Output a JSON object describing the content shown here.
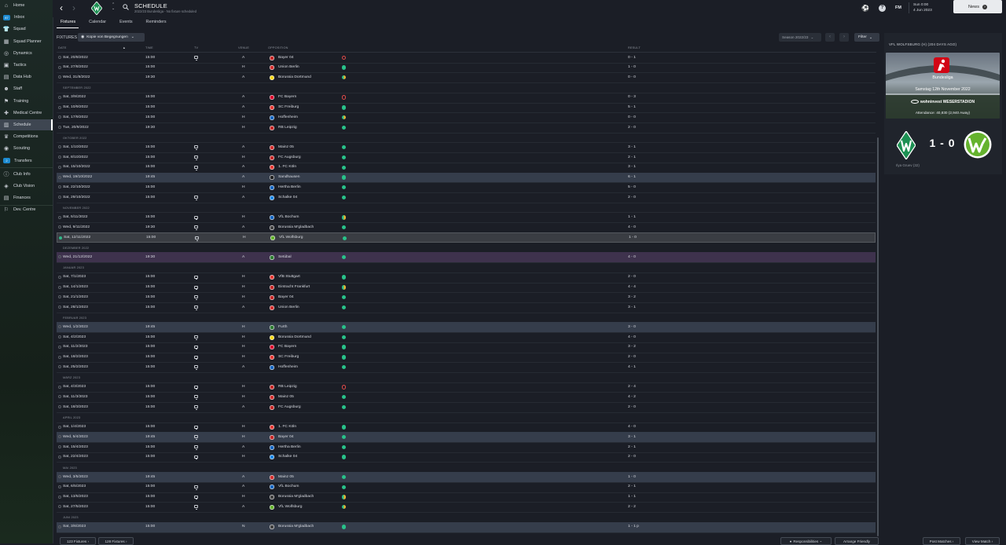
{
  "sidebar": {
    "items": [
      {
        "label": "Home",
        "icon": "home-icon"
      },
      {
        "label": "Inbox",
        "icon": "inbox-icon",
        "badge": "87"
      },
      {
        "label": "Squad",
        "icon": "shirt-icon"
      },
      {
        "label": "Squad Planner",
        "icon": "planner-icon"
      },
      {
        "label": "Dynamics",
        "icon": "dynamics-icon"
      },
      {
        "label": "Tactics",
        "icon": "tactics-icon"
      },
      {
        "label": "Data Hub",
        "icon": "data-hub-icon"
      },
      {
        "label": "Staff",
        "icon": "staff-icon"
      },
      {
        "label": "Training",
        "icon": "training-icon"
      },
      {
        "label": "Medical Centre",
        "icon": "medical-icon"
      },
      {
        "label": "Schedule",
        "icon": "schedule-icon",
        "active": true
      },
      {
        "label": "Competitions",
        "icon": "trophy-icon"
      },
      {
        "label": "Scouting",
        "icon": "scouting-icon"
      },
      {
        "label": "Transfers",
        "icon": "transfers-icon",
        "badge": "2"
      },
      {
        "label": "Club Info",
        "icon": "club-info-icon"
      },
      {
        "label": "Club Vision",
        "icon": "club-vision-icon"
      },
      {
        "label": "Finances",
        "icon": "finances-icon"
      },
      {
        "label": "Dev. Centre",
        "icon": "dev-centre-icon"
      }
    ]
  },
  "header": {
    "title": "SCHEDULE",
    "subtitle": "2022/23 Bundesliga - No fixture scheduled",
    "fm_label": "FM",
    "date_line1": "Sun 0:00",
    "date_line2": "4 Jun 2023",
    "news_label": "News"
  },
  "tabs": [
    "Fixtures",
    "Calendar",
    "Events",
    "Reminders"
  ],
  "fixtures": {
    "label": "FIXTURES",
    "view_option": "Kopie von Begegnungen",
    "season": "Season 2022/23",
    "filter_label": "Filter",
    "columns": {
      "date": "Date",
      "time": "Time",
      "tv": "TV",
      "venue": "Venue",
      "opposition": "Opposition",
      "result": "Result"
    },
    "rows": [
      {
        "date": "Sat, 20/8/2022",
        "time": "15:00",
        "tv": true,
        "venue": "A",
        "opp": "Bayer 04",
        "outcome": "l",
        "result": "0 - 1",
        "badge": "#c62828"
      },
      {
        "date": "Sat, 27/8/2022",
        "time": "15:00",
        "tv": false,
        "venue": "H",
        "opp": "Union Berlin",
        "outcome": "w",
        "result": "1 - 0",
        "badge": "#d32f2f"
      },
      {
        "date": "Wed, 31/8/2022",
        "time": "19:30",
        "tv": false,
        "venue": "A",
        "opp": "Borussia Dortmund",
        "outcome": "d",
        "result": "0 - 0",
        "badge": "#f9d71c"
      },
      {
        "month": "September 2022"
      },
      {
        "date": "Sat, 3/9/2022",
        "time": "15:00",
        "tv": false,
        "venue": "A",
        "opp": "FC Bayern",
        "outcome": "l",
        "result": "0 - 3",
        "badge": "#dc052d"
      },
      {
        "date": "Sat, 10/9/2022",
        "time": "15:00",
        "tv": false,
        "venue": "A",
        "opp": "SC Freiburg",
        "outcome": "w",
        "result": "5 - 1",
        "badge": "#e53935"
      },
      {
        "date": "Sat, 17/9/2022",
        "time": "15:00",
        "tv": false,
        "venue": "H",
        "opp": "Hoffenheim",
        "outcome": "d",
        "result": "0 - 0",
        "badge": "#1565c0"
      },
      {
        "date": "Tue, 20/9/2022",
        "time": "19:30",
        "tv": false,
        "venue": "H",
        "opp": "RB Leipzig",
        "outcome": "w",
        "result": "2 - 0",
        "badge": "#c62828"
      },
      {
        "month": "Oktober 2022"
      },
      {
        "date": "Sat, 1/10/2022",
        "time": "15:00",
        "tv": true,
        "venue": "A",
        "opp": "Mainz 05",
        "outcome": "w",
        "result": "3 - 1",
        "badge": "#d32f2f"
      },
      {
        "date": "Sat, 8/10/2022",
        "time": "15:00",
        "tv": true,
        "venue": "H",
        "opp": "FC Augsburg",
        "outcome": "w",
        "result": "2 - 1",
        "badge": "#c62828"
      },
      {
        "date": "Sat, 15/10/2022",
        "time": "15:00",
        "tv": true,
        "venue": "A",
        "opp": "1. FC Köln",
        "outcome": "w",
        "result": "3 - 1",
        "badge": "#e53935"
      },
      {
        "date": "Wed, 19/10/2022",
        "time": "19:45",
        "tv": false,
        "venue": "A",
        "opp": "Sandhausen",
        "outcome": "w",
        "result": "6 - 1",
        "badge": "#212121",
        "hl": "blue"
      },
      {
        "date": "Sat, 22/10/2022",
        "time": "15:00",
        "tv": false,
        "venue": "H",
        "opp": "Hertha Berlin",
        "outcome": "w",
        "result": "5 - 0",
        "badge": "#1565c0"
      },
      {
        "date": "Sat, 29/10/2022",
        "time": "15:00",
        "tv": true,
        "venue": "A",
        "opp": "Schalke 04",
        "outcome": "w",
        "result": "2 - 0",
        "badge": "#1e88e5"
      },
      {
        "month": "November 2022"
      },
      {
        "date": "Sat, 5/11/2022",
        "time": "15:00",
        "tv": true,
        "venue": "H",
        "opp": "VfL Bochum",
        "outcome": "d",
        "result": "1 - 1",
        "badge": "#1565c0"
      },
      {
        "date": "Wed, 9/11/2022",
        "time": "19:30",
        "tv": true,
        "venue": "A",
        "opp": "Borussia M'gladbach",
        "outcome": "w",
        "result": "4 - 0",
        "badge": "#424242"
      },
      {
        "date": "Sat, 12/11/2022",
        "time": "15:00",
        "tv": true,
        "venue": "H",
        "opp": "VfL Wolfsburg",
        "outcome": "w",
        "result": "1 - 0",
        "badge": "#65b32e",
        "hl": "gray",
        "selected": true
      },
      {
        "month": "Dezember 2022"
      },
      {
        "date": "Wed, 21/12/2022",
        "time": "19:30",
        "tv": false,
        "venue": "A",
        "opp": "Setúbal",
        "outcome": "w",
        "result": "4 - 0",
        "badge": "#2e7d32",
        "hl": "purple"
      },
      {
        "month": "Januar 2023"
      },
      {
        "date": "Sat, 7/1/2023",
        "time": "15:00",
        "tv": true,
        "venue": "H",
        "opp": "VfB Stuttgart",
        "outcome": "w",
        "result": "2 - 0",
        "badge": "#e53935"
      },
      {
        "date": "Sat, 14/1/2023",
        "time": "15:00",
        "tv": true,
        "venue": "H",
        "opp": "Eintracht Frankfurt",
        "outcome": "d",
        "result": "4 - 4",
        "badge": "#c62828"
      },
      {
        "date": "Sat, 21/1/2023",
        "time": "15:00",
        "tv": true,
        "venue": "H",
        "opp": "Bayer 04",
        "outcome": "w",
        "result": "3 - 2",
        "badge": "#c62828"
      },
      {
        "date": "Sat, 28/1/2023",
        "time": "15:00",
        "tv": true,
        "venue": "A",
        "opp": "Union Berlin",
        "outcome": "w",
        "result": "3 - 1",
        "badge": "#d32f2f"
      },
      {
        "month": "Februar 2023"
      },
      {
        "date": "Wed, 1/2/2023",
        "time": "19:45",
        "tv": false,
        "venue": "H",
        "opp": "Furth",
        "outcome": "w",
        "result": "3 - 0",
        "badge": "#2e7d32",
        "hl": "blue"
      },
      {
        "date": "Sat, 4/2/2023",
        "time": "15:00",
        "tv": true,
        "venue": "H",
        "opp": "Borussia Dortmund",
        "outcome": "w",
        "result": "4 - 0",
        "badge": "#f9d71c"
      },
      {
        "date": "Sat, 11/2/2023",
        "time": "15:00",
        "tv": true,
        "venue": "H",
        "opp": "FC Bayern",
        "outcome": "w",
        "result": "3 - 2",
        "badge": "#dc052d"
      },
      {
        "date": "Sat, 18/2/2023",
        "time": "15:00",
        "tv": true,
        "venue": "H",
        "opp": "SC Freiburg",
        "outcome": "w",
        "result": "2 - 0",
        "badge": "#e53935"
      },
      {
        "date": "Sat, 25/2/2023",
        "time": "15:00",
        "tv": true,
        "venue": "A",
        "opp": "Hoffenheim",
        "outcome": "w",
        "result": "4 - 1",
        "badge": "#1565c0"
      },
      {
        "month": "März 2023"
      },
      {
        "date": "Sat, 4/3/2023",
        "time": "15:00",
        "tv": true,
        "venue": "H",
        "opp": "RB Leipzig",
        "outcome": "l",
        "result": "2 - 4",
        "badge": "#c62828"
      },
      {
        "date": "Sat, 11/3/2023",
        "time": "15:00",
        "tv": true,
        "venue": "H",
        "opp": "Mainz 05",
        "outcome": "w",
        "result": "4 - 2",
        "badge": "#d32f2f"
      },
      {
        "date": "Sat, 18/3/2023",
        "time": "15:00",
        "tv": true,
        "venue": "A",
        "opp": "FC Augsburg",
        "outcome": "w",
        "result": "2 - 0",
        "badge": "#c62828"
      },
      {
        "month": "April 2023"
      },
      {
        "date": "Sat, 1/4/2023",
        "time": "15:00",
        "tv": true,
        "venue": "H",
        "opp": "1. FC Köln",
        "outcome": "w",
        "result": "4 - 0",
        "badge": "#e53935"
      },
      {
        "date": "Wed, 5/4/2023",
        "time": "19:45",
        "tv": true,
        "venue": "H",
        "opp": "Bayer 04",
        "outcome": "w",
        "result": "3 - 1",
        "badge": "#c62828",
        "hl": "blue"
      },
      {
        "date": "Sat, 15/4/2023",
        "time": "15:00",
        "tv": true,
        "venue": "A",
        "opp": "Hertha Berlin",
        "outcome": "w",
        "result": "2 - 1",
        "badge": "#1565c0"
      },
      {
        "date": "Sat, 22/4/2023",
        "time": "15:00",
        "tv": true,
        "venue": "H",
        "opp": "Schalke 04",
        "outcome": "w",
        "result": "2 - 0",
        "badge": "#1e88e5"
      },
      {
        "month": "Mai 2023"
      },
      {
        "date": "Wed, 3/5/2023",
        "time": "19:45",
        "tv": false,
        "venue": "A",
        "opp": "Mainz 05",
        "outcome": "w",
        "result": "1 - 0",
        "badge": "#d32f2f",
        "hl": "blue"
      },
      {
        "date": "Sat, 6/5/2023",
        "time": "15:00",
        "tv": true,
        "venue": "A",
        "opp": "VfL Bochum",
        "outcome": "w",
        "result": "2 - 1",
        "badge": "#1565c0"
      },
      {
        "date": "Sat, 13/5/2023",
        "time": "15:00",
        "tv": true,
        "venue": "H",
        "opp": "Borussia M'gladbach",
        "outcome": "d",
        "result": "1 - 1",
        "badge": "#424242"
      },
      {
        "date": "Sat, 27/5/2023",
        "time": "15:00",
        "tv": true,
        "venue": "A",
        "opp": "VfL Wolfsburg",
        "outcome": "d",
        "result": "2 - 2",
        "badge": "#65b32e"
      },
      {
        "month": "Juni 2023"
      },
      {
        "date": "Sat, 3/6/2023",
        "time": "15:00",
        "tv": false,
        "venue": "N",
        "opp": "Borussia M'gladbach",
        "outcome": "w",
        "result": "1 - 1 p",
        "badge": "#424242",
        "hl": "blue"
      }
    ]
  },
  "bottom": {
    "prev_fixtures": "123 Fixtures",
    "next_fixtures": "128 Fixtures",
    "responsibilities": "Responsibilities",
    "arrange_friendly": "Arrange Friendly",
    "post_match": "Post Matches",
    "view_match": "View Match"
  },
  "match_panel": {
    "title": "VfL Wolfsburg (H) (204 days ago)",
    "competition": "Bundesliga",
    "date": "Samstag 12th November 2022",
    "stadium": "wohninvest WESERSTADION",
    "attendance": "Attendance: 40,830 (2,940 Away)",
    "score": "1 - 0",
    "scorer": "Ilya Gruev (32)"
  },
  "colors": {
    "win": "#28c28a",
    "draw": "#f0b030",
    "loss": "#e04a4a",
    "werder_green": "#1d9053",
    "wolfsburg_green": "#65b32e"
  }
}
